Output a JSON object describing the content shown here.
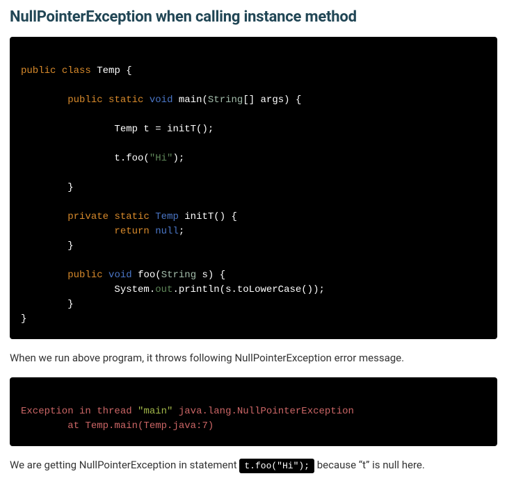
{
  "heading": "NullPointerException when calling instance method",
  "code1": {
    "l1a": "public",
    "l1b": "class",
    "l1c": "Temp",
    "l1d": " {",
    "l2a": "public",
    "l2b": "static",
    "l2c": "void",
    "l2d": "main",
    "l2e": "String",
    "l2f": "[] args",
    "l2g": ") {",
    "l3a": "Temp t ",
    "l3b": "=",
    "l3c": " initT();",
    "l4a": "t.foo(",
    "l4b": "\"Hi\"",
    "l4c": ");",
    "l5a": "}",
    "l6a": "private",
    "l6b": "static",
    "l6c": "Temp",
    "l6d": "initT",
    "l6e": "() {",
    "l7a": "return",
    "l7b": "null",
    "l7c": ";",
    "l8a": "}",
    "l9a": "public",
    "l9b": "void",
    "l9c": "foo",
    "l9d": "String",
    "l9e": " s",
    "l9f": ") {",
    "l10a": "System.",
    "l10b": "out",
    "l10c": ".println(s.toLowerCase());",
    "l11a": "}",
    "l12a": "}"
  },
  "prose1": "When we run above program, it throws following NullPointerException error message.",
  "code2": {
    "l1a": "Exception ",
    "l1b": "in",
    "l1c": " thread ",
    "l1d": "\"main\"",
    "l1e": " java.lang.NullPointerException",
    "l2a": "at Temp.main(Temp.java:",
    "l2b": "7",
    "l2c": ")"
  },
  "prose2a": "We are getting NullPointerException in statement ",
  "prose2_code": "t.foo(\"Hi\");",
  "prose2b": " because “t” is null here."
}
